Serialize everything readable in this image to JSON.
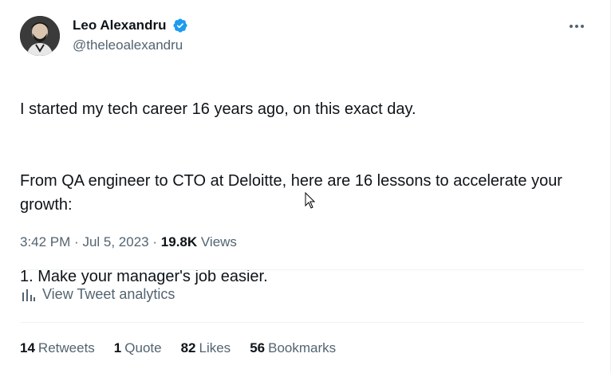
{
  "author": {
    "display_name": "Leo Alexandru",
    "handle": "@theleoalexandru",
    "verified": true,
    "verified_color": "#1d9bf0"
  },
  "tweet": {
    "paragraphs": [
      "I started my tech career 16 years ago, on this exact day.",
      "From QA engineer to CTO at Deloitte, here are 16 lessons to accelerate your growth:",
      "1. Make your manager's job easier."
    ]
  },
  "meta": {
    "time": "3:42 PM",
    "separator": "·",
    "date": "Jul 5, 2023",
    "views_count": "19.8K",
    "views_label": "Views"
  },
  "analytics": {
    "label": "View Tweet analytics",
    "icon": "bar-chart-icon"
  },
  "stats": [
    {
      "count": "14",
      "label": "Retweets"
    },
    {
      "count": "1",
      "label": "Quote"
    },
    {
      "count": "82",
      "label": "Likes"
    },
    {
      "count": "56",
      "label": "Bookmarks"
    }
  ],
  "colors": {
    "text_primary": "#0f1419",
    "text_secondary": "#536471",
    "divider": "#eff3f4"
  }
}
